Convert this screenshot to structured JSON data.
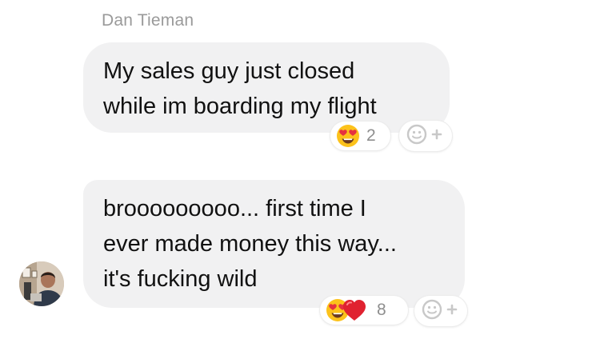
{
  "conversation": {
    "sender_name": "Dan Tieman",
    "messages": [
      {
        "lines": [
          "My sales guy just closed",
          "while im boarding my flight"
        ],
        "reactions": {
          "emojis": [
            "heart-eyes-face"
          ],
          "count": "2"
        }
      },
      {
        "lines": [
          "brooooooooo... first time I",
          "ever made money this way...",
          "it's fucking wild"
        ],
        "reactions": {
          "emojis": [
            "heart-eyes-face",
            "red-heart"
          ],
          "count": "8"
        }
      }
    ]
  },
  "colors": {
    "bubble_background": "#f1f1f2",
    "sender_name": "#9a9a9a",
    "reaction_count": "#8e8e8e",
    "add_reaction_icon": "#c8c8c8"
  },
  "icons": {
    "add_reaction": "smiley-plus-icon",
    "avatar": "user-avatar-photo"
  }
}
